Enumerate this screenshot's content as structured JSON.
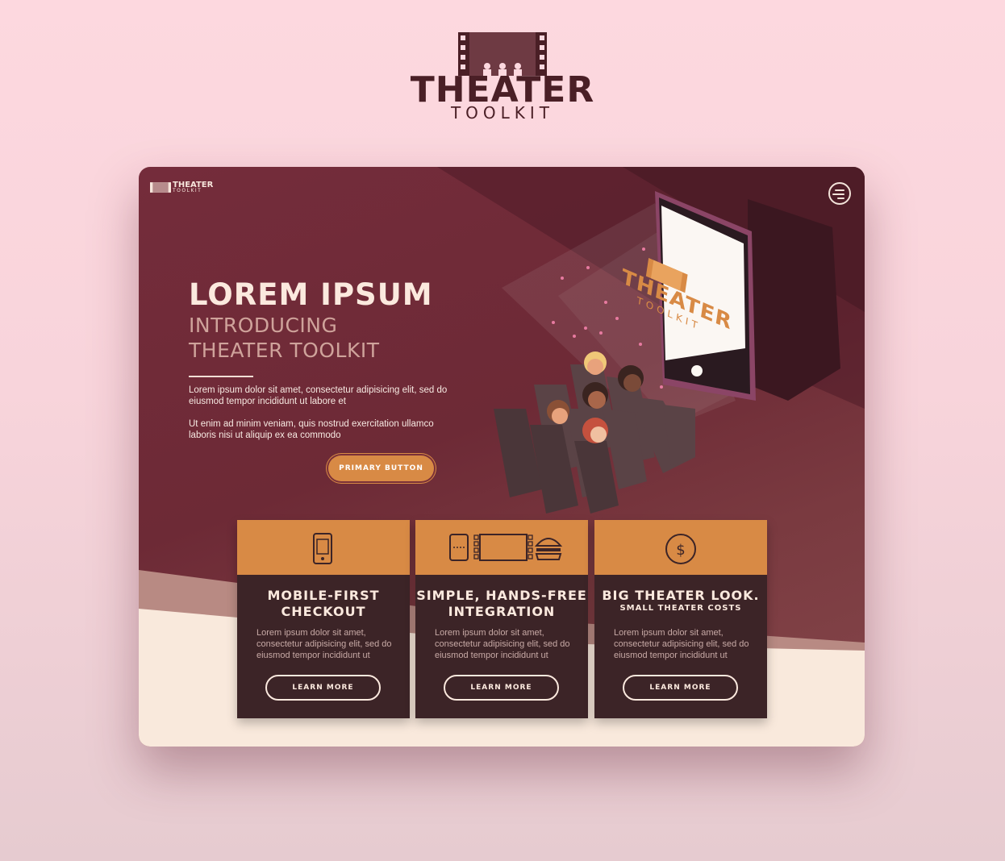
{
  "brand": {
    "title": "THEATER",
    "subtitle": "TOOLKIT",
    "icon": "theater-film-icon"
  },
  "nav": {
    "logo_title": "THEATER",
    "logo_subtitle": "TOOLKIT",
    "menu_icon": "hamburger-menu-icon"
  },
  "hero": {
    "title": "LOREM IPSUM",
    "subtitle_line1": "INTRODUCING",
    "subtitle_line2": "THEATER TOOLKIT",
    "paragraph1": "Lorem ipsum dolor sit amet, consectetur adipisicing elit, sed do eiusmod tempor incididunt ut labore et",
    "paragraph2": "Ut enim ad minim veniam, quis nostrud exercitation ullamco laboris nisi ut aliquip ex ea commodo",
    "button_label": "PRIMARY BUTTON"
  },
  "illustration": {
    "screen_title": "THEATER",
    "screen_subtitle": "TOOLKIT"
  },
  "cards": [
    {
      "icon": "mobile-phone-icon",
      "title_line1": "MOBILE-FIRST",
      "title_line2": "CHECKOUT",
      "body": "Lorem ipsum dolor sit amet, consectetur adipisicing elit, sed do eiusmod tempor incididunt ut",
      "button": "LEARN MORE"
    },
    {
      "icon": "ticket-screen-burger-icon",
      "title_line1": "SIMPLE, HANDS-FREE",
      "title_line2": "INTEGRATION",
      "body": "Lorem ipsum dolor sit amet, consectetur adipisicing elit, sed do eiusmod tempor incididunt ut",
      "button": "LEARN MORE"
    },
    {
      "icon": "dollar-coin-icon",
      "title_line1": "BIG THEATER LOOK.",
      "title_line2": "SMALL THEATER COSTS",
      "body": "Lorem ipsum dolor sit amet, consectetur adipisicing elit, sed do eiusmod tempor incididunt ut",
      "button": "LEARN MORE"
    }
  ],
  "colors": {
    "background": "#fdd8df",
    "maroon": "#6d2a36",
    "accent_orange": "#d88a45",
    "card_dark": "#3c2427",
    "cream": "#f9e9dc"
  }
}
